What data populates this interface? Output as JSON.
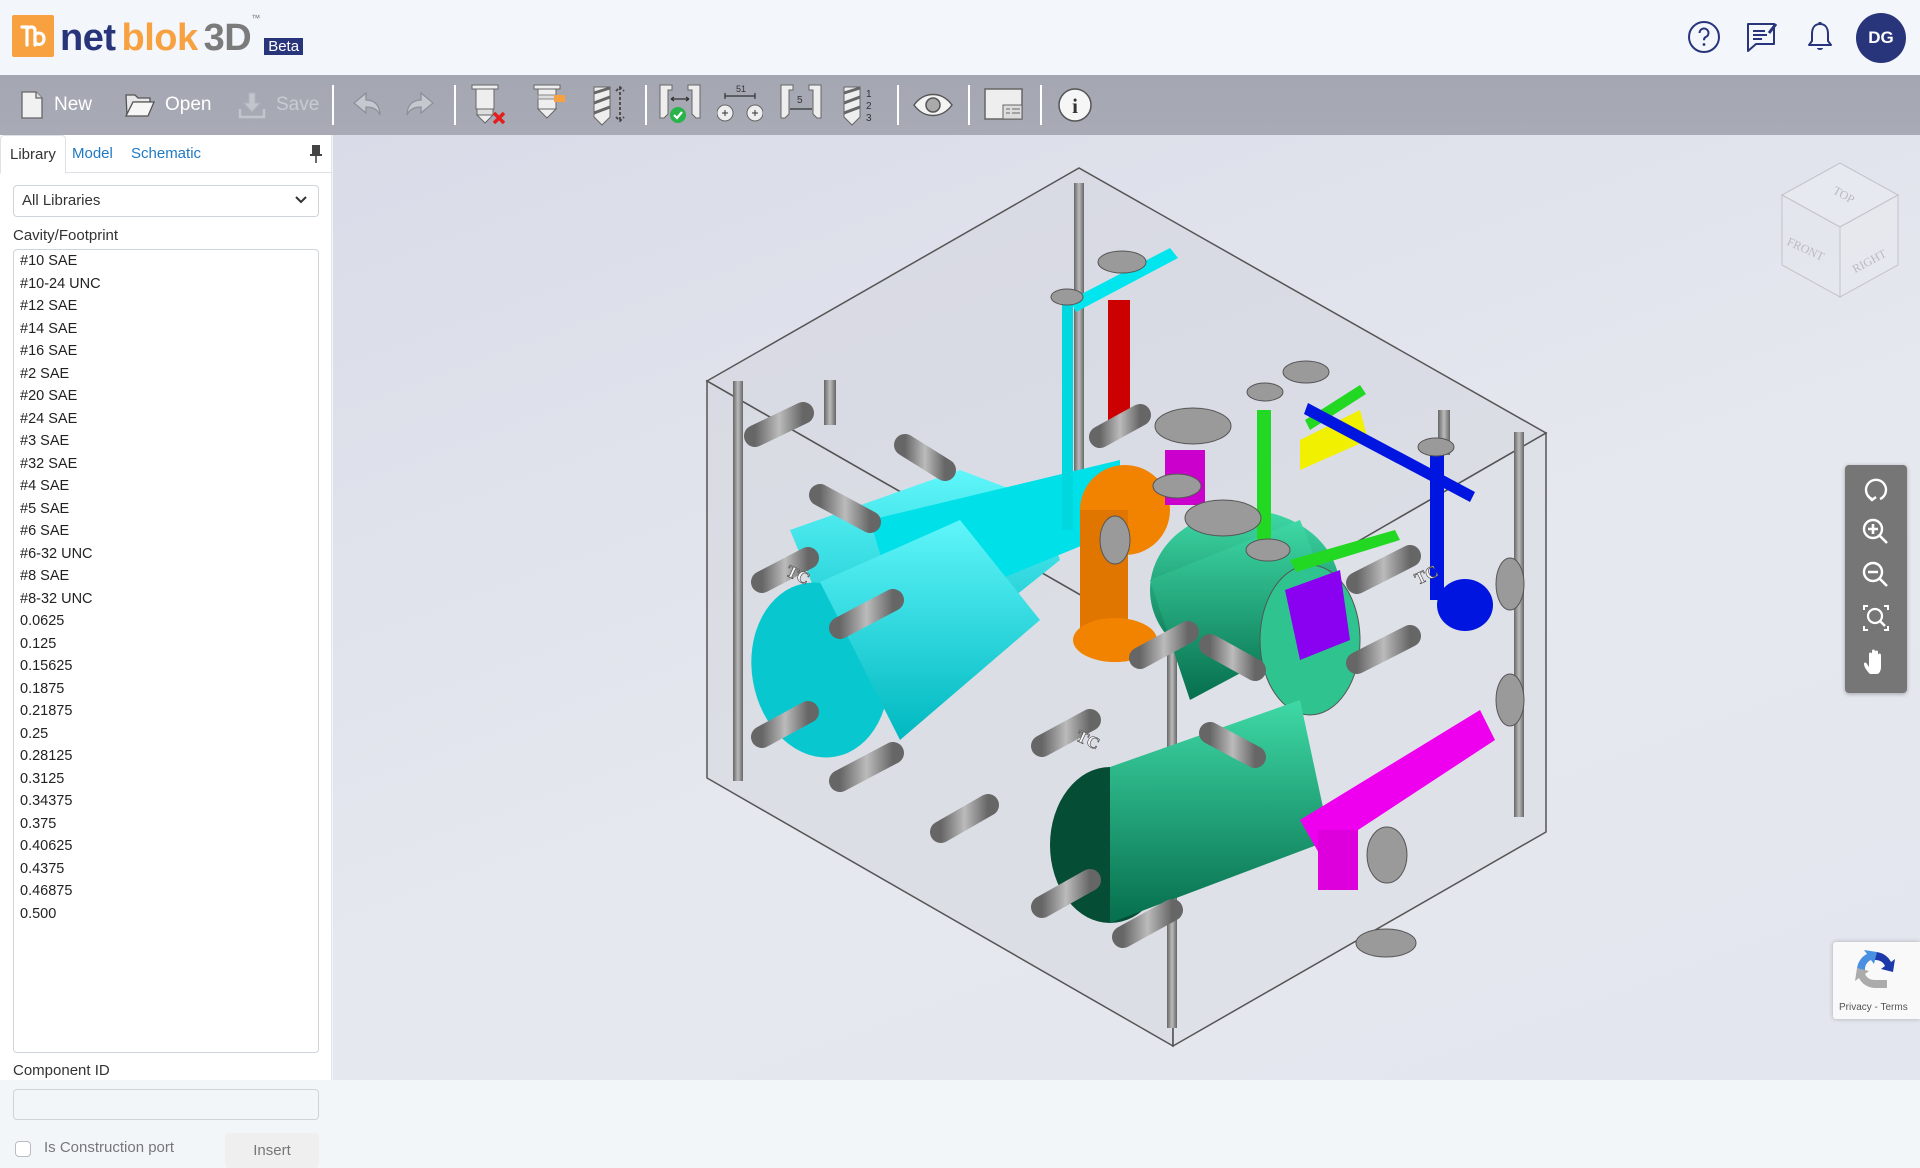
{
  "header": {
    "logo": {
      "part1": "net",
      "part2": "blok",
      "part3": "3D",
      "trademark": "™",
      "badge": "Beta"
    },
    "icons": [
      "help-icon",
      "feedback-icon",
      "notification-bell-icon"
    ],
    "user_initials": "DG"
  },
  "toolbar": {
    "new_label": "New",
    "open_label": "Open",
    "save_label": "Save",
    "spacing_value": "51",
    "distance_value": "5",
    "order_digits": [
      "1",
      "2",
      "3"
    ],
    "info_glyph": "i"
  },
  "sidebar": {
    "tabs": [
      {
        "label": "Library",
        "active": true
      },
      {
        "label": "Model",
        "active": false
      },
      {
        "label": "Schematic",
        "active": false
      }
    ],
    "library_select": "All Libraries",
    "cavity_label": "Cavity/Footprint",
    "cavities": [
      "#10 SAE",
      "#10-24 UNC",
      "#12 SAE",
      "#14 SAE",
      "#16 SAE",
      "#2 SAE",
      "#20 SAE",
      "#24 SAE",
      "#3 SAE",
      "#32 SAE",
      "#4 SAE",
      "#5 SAE",
      "#6 SAE",
      "#6-32 UNC",
      "#8 SAE",
      "#8-32 UNC",
      "0.0625",
      "0.125",
      "0.15625",
      "0.1875",
      "0.21875",
      "0.25",
      "0.28125",
      "0.3125",
      "0.34375",
      "0.375",
      "0.40625",
      "0.4375",
      "0.46875",
      "0.500"
    ],
    "component_id_label": "Component ID",
    "component_id_value": "",
    "construction_port_label": "Is Construction port",
    "construction_port_checked": false,
    "insert_label": "Insert"
  },
  "viewport": {
    "viewcube_faces": {
      "top": "TOP",
      "front": "FRONT",
      "right": "RIGHT"
    },
    "tools": [
      "rotate-icon",
      "zoom-in-icon",
      "zoom-out-icon",
      "zoom-fit-icon",
      "pan-hand-icon"
    ],
    "model_labels": [
      "TC",
      "TC",
      "TC"
    ],
    "colors": {
      "cyan": "#00e5ee",
      "red": "#cc0000",
      "orange": "#f28300",
      "teal": "#1fb585",
      "magenta": "#ee00ee",
      "purple": "#8a00f0",
      "green": "#22d822",
      "yellow": "#f0f000",
      "blue": "#0016e0",
      "steel": "#8a8a8a"
    }
  },
  "recaptcha": {
    "text": "Privacy - Terms"
  }
}
